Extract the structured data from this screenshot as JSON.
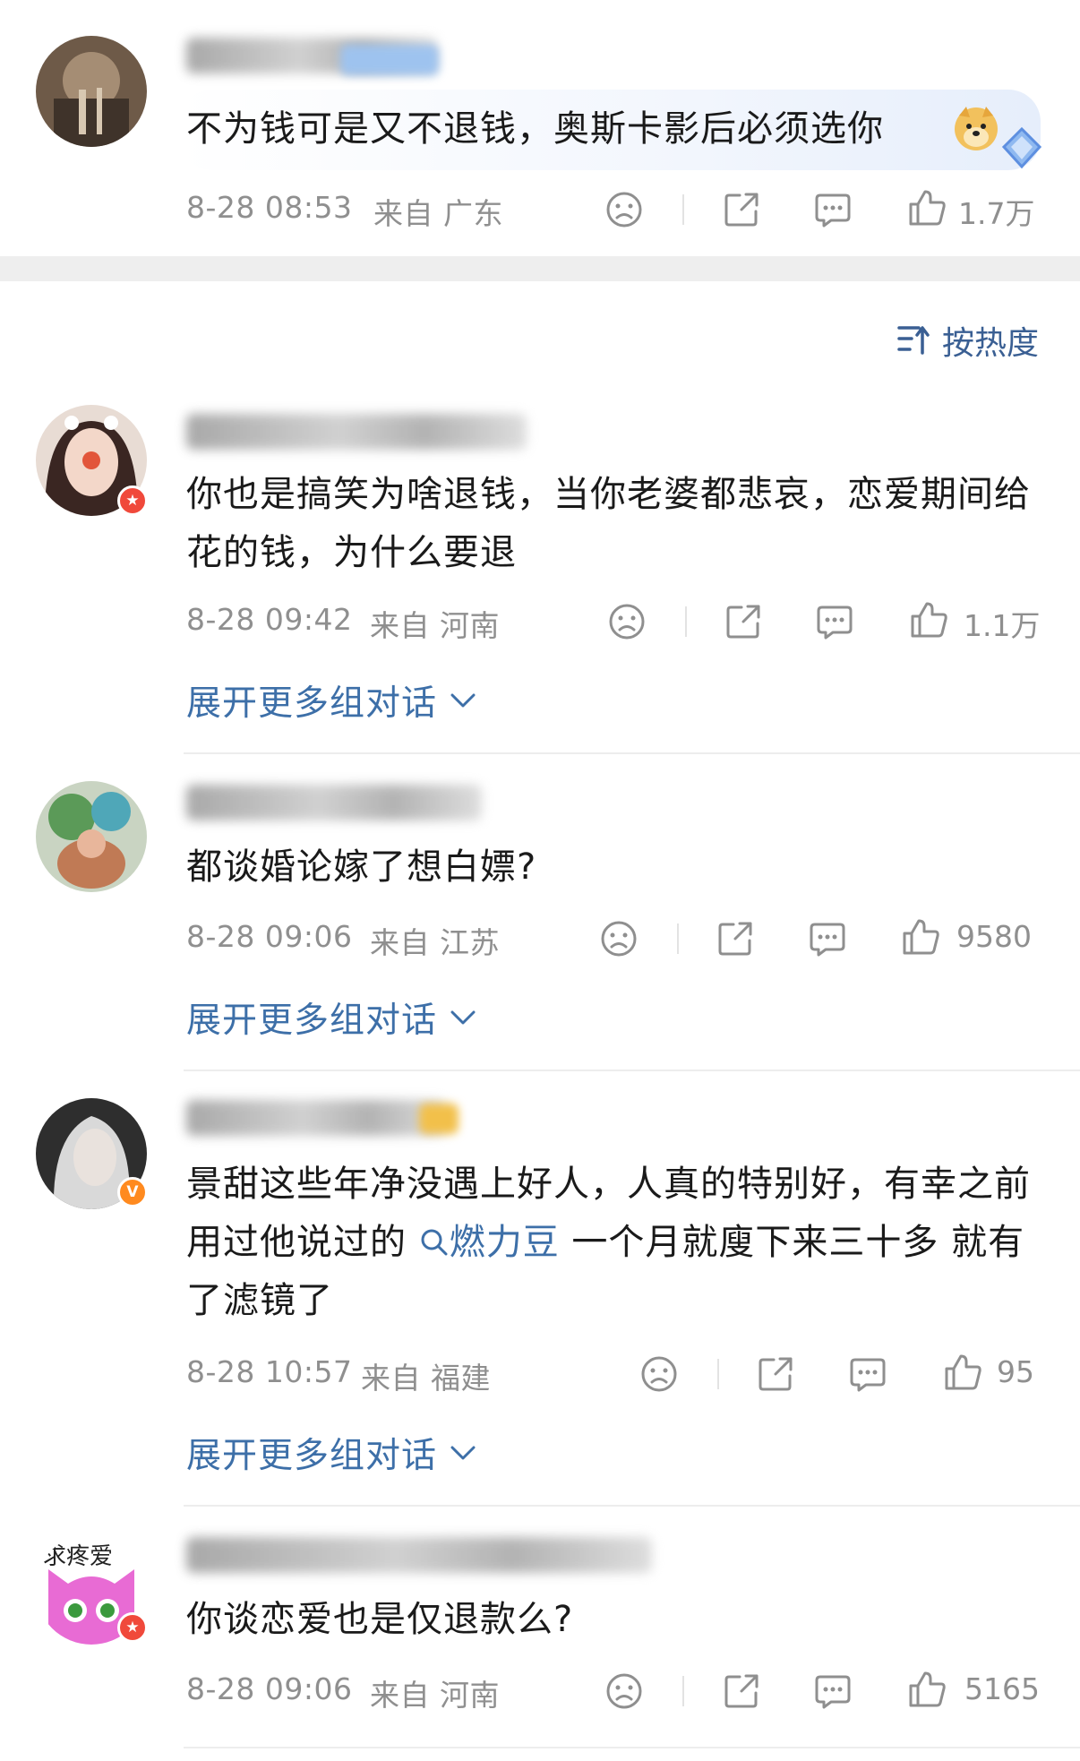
{
  "sort_label": "按热度",
  "expand_label": "展开更多组对话",
  "comments": [
    {
      "text": "不为钱可是又不退钱，奥斯卡影后必须选你",
      "time": "8-28 08:53",
      "origin": "来自 广东",
      "likes": "1.7万"
    },
    {
      "text": "你也是搞笑为啥退钱，当你老婆都悲哀，恋爱期间给花的钱，为什么要退",
      "time": "8-28 09:42",
      "origin": "来自 河南",
      "likes": "1.1万"
    },
    {
      "text": "都谈婚论嫁了想白嫖?",
      "time": "8-28 09:06",
      "origin": "来自 江苏",
      "likes": "9580"
    },
    {
      "text_before": "景甜这些年净没遇上好人，人真的特别好，有幸之前用过他说过的",
      "link": "燃力豆",
      "text_after": " 一个月就廋下来三十多 就有了滤镜了",
      "time": "8-28 10:57",
      "origin": "来自 福建",
      "likes": "95"
    },
    {
      "text": "你谈恋爱也是仅退款么?",
      "time": "8-28 09:06",
      "origin": "来自 河南",
      "likes": "5165"
    }
  ],
  "avatar_text": "求疼爱"
}
